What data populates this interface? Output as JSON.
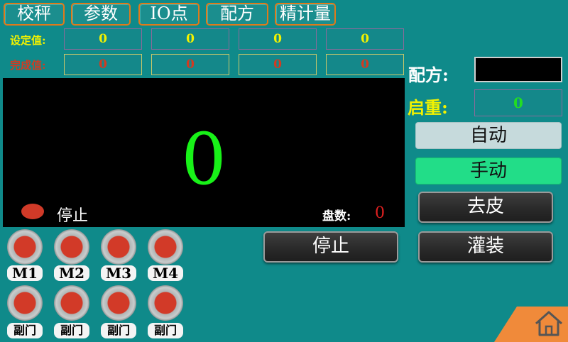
{
  "tabs": [
    "校秤",
    "参数",
    "IO点",
    "配方",
    "精计量"
  ],
  "rows": {
    "set_label": "设定值:",
    "set_values": [
      "0",
      "0",
      "0",
      "0"
    ],
    "done_label": "完成值:",
    "done_values": [
      "0",
      "0",
      "0",
      "0"
    ]
  },
  "display": {
    "weight": "0",
    "status": "停止",
    "count_label": "盘数:",
    "count_value": "0"
  },
  "side": {
    "recipe_label": "配方:",
    "start_weight_label": "启重:",
    "start_weight_value": "0",
    "auto_label": "自动",
    "manual_label": "手动",
    "tare_label": "去皮",
    "fill_label": "灌装",
    "stop_label": "停止"
  },
  "motors": {
    "labels": [
      "M1",
      "M2",
      "M3",
      "M4"
    ],
    "gate_labels": [
      "副门",
      "副门",
      "副门",
      "副门"
    ]
  },
  "colors": {
    "background": "#0f8a8a",
    "tab_border": "#e07a1a",
    "weight_text": "#18f218",
    "lamp_on": "#d23a28",
    "manual_active": "#22dd88",
    "home": "#f08a3a"
  },
  "icons": {
    "home": "home-icon",
    "status": "status-indicator"
  }
}
